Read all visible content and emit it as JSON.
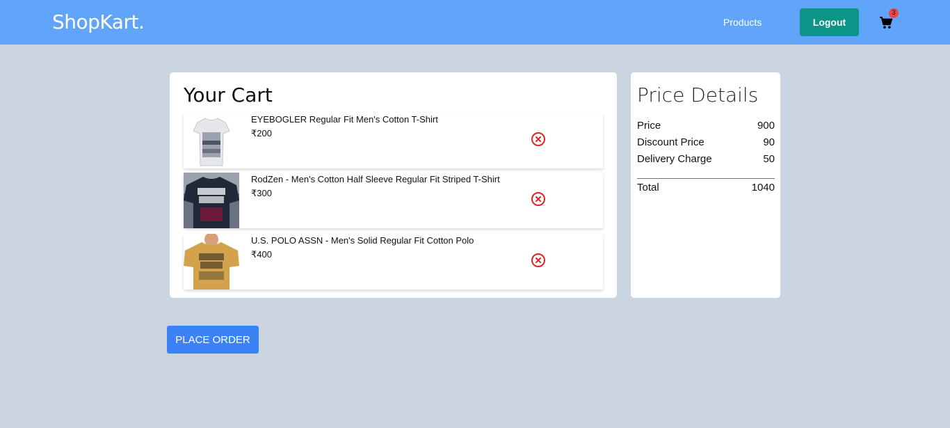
{
  "navbar": {
    "brand": "ShopKart.",
    "products_link": "Products",
    "logout_label": "Logout",
    "cart_count": "3",
    "cart_icon": "shopping-cart-icon",
    "colors": {
      "bar": "#60a5fa",
      "logout": "#0d9488",
      "badge": "#ef4444"
    }
  },
  "cart": {
    "title": "Your Cart",
    "items": [
      {
        "name": "EYEBOGLER Regular Fit Men's Cotton T-Shirt",
        "price": "₹200",
        "image": "white-tshirt-image",
        "remove_icon": "remove-circle-x-icon"
      },
      {
        "name": "RodZen - Men's Cotton Half Sleeve Regular Fit Striped T-Shirt",
        "price": "₹300",
        "image": "black-graphic-tshirt-image",
        "remove_icon": "remove-circle-x-icon"
      },
      {
        "name": "U.S. POLO ASSN - Men's Solid Regular Fit Cotton Polo",
        "price": "₹400",
        "image": "mustard-graphic-tshirt-image",
        "remove_icon": "remove-circle-x-icon"
      }
    ]
  },
  "price_details": {
    "title": "Price Details",
    "rows": [
      {
        "label": "Price",
        "value": "900"
      },
      {
        "label": "Discount Price",
        "value": "90"
      },
      {
        "label": "Delivery Charge",
        "value": "50"
      }
    ],
    "total": {
      "label": "Total",
      "value": "1040"
    }
  },
  "actions": {
    "place_order": "PLACE ORDER",
    "colors": {
      "place_order": "#3b82f6",
      "remove": "#dc2626"
    }
  }
}
